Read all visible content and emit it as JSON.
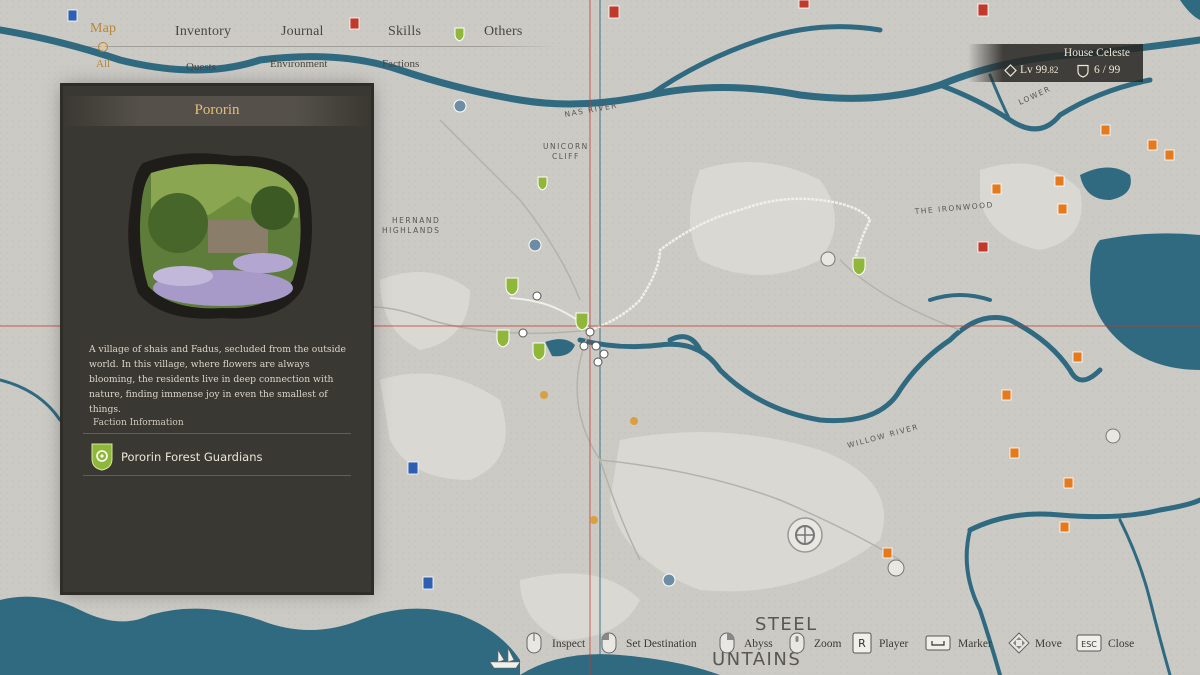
{
  "nav": {
    "tabs": [
      {
        "label": "Map",
        "active": true
      },
      {
        "label": "Inventory",
        "active": false
      },
      {
        "label": "Journal",
        "active": false
      },
      {
        "label": "Skills",
        "active": false
      },
      {
        "label": "Others",
        "active": false
      }
    ],
    "subtabs": [
      {
        "label": "All",
        "active": true
      },
      {
        "label": "Quests",
        "active": false
      },
      {
        "label": "Environment",
        "active": false
      },
      {
        "label": "Factions",
        "active": false
      }
    ]
  },
  "panel": {
    "title": "Pororin",
    "description": "A village of shais and Fadus, secluded from the outside world. In this village, where flowers are always blooming, the residents live in deep connection with nature, finding immense joy in even the smallest of things.",
    "faction_info_label": "Faction Information",
    "faction_name": "Pororin Forest Guardians",
    "faction_color": "#8fb83a"
  },
  "player": {
    "house": "House Celeste",
    "level_prefix": "Lv",
    "level_int": "99",
    "level_dec": ".82",
    "count": "6 / 99"
  },
  "map_labels": {
    "nas_river": "NAS RIVER",
    "unicorn_cliff_1": "UNICORN",
    "unicorn_cliff_2": "CLIFF",
    "hernand_1": "HERNAND",
    "hernand_2": "HIGHLANDS",
    "ironwood": "THE IRONWOOD",
    "lower": "LOWER",
    "willow": "WILLOW RIVER",
    "steel": "STEEL",
    "untains": "UNTAINS"
  },
  "controls": [
    {
      "key": "mouse",
      "label": "Inspect"
    },
    {
      "key": "mouse-left",
      "label": "Set Destination"
    },
    {
      "key": "mouse-right",
      "label": "Abyss"
    },
    {
      "key": "mouse-wheel",
      "label": "Zoom"
    },
    {
      "key": "R",
      "label": "Player"
    },
    {
      "key": "space",
      "label": "Marker"
    },
    {
      "key": "dpad",
      "label": "Move"
    },
    {
      "key": "ESC",
      "label": "Close"
    }
  ],
  "colors": {
    "water": "#2f6a80",
    "accent_gold": "#b8873a",
    "crosshair": "#c0392b",
    "faction_green": "#8fb83a",
    "enemy_orange": "#e57a1c",
    "enemy_red": "#c0392b",
    "ally_blue": "#2f5fb3"
  }
}
